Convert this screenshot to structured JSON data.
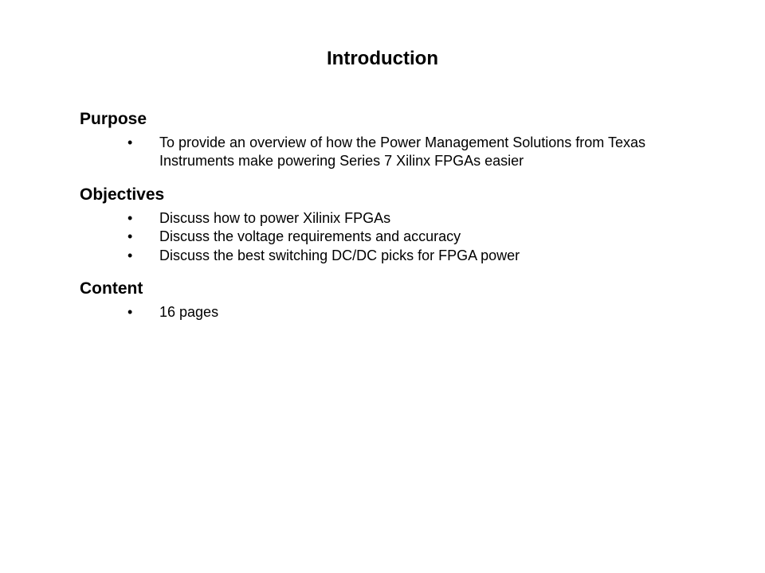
{
  "title": "Introduction",
  "sections": {
    "purpose": {
      "heading": "Purpose",
      "items": [
        "To provide an overview of how the Power Management Solutions from Texas Instruments make powering Series 7 Xilinx FPGAs easier"
      ]
    },
    "objectives": {
      "heading": "Objectives",
      "items": [
        "Discuss how to power Xilinix FPGAs",
        "Discuss the voltage requirements and accuracy",
        "Discuss the best switching DC/DC picks for FPGA power"
      ]
    },
    "content": {
      "heading": "Content",
      "items": [
        "16 pages"
      ]
    }
  }
}
